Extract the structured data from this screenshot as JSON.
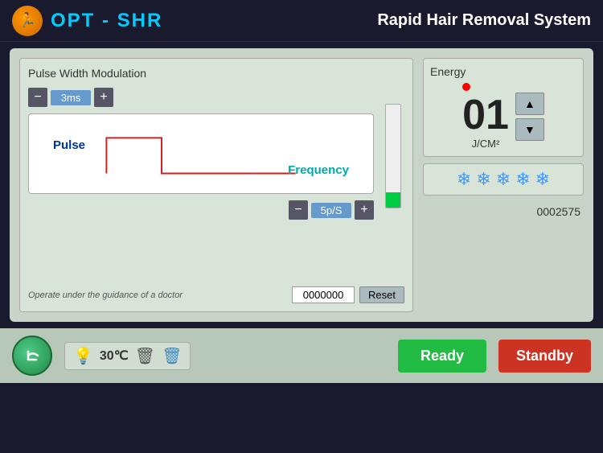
{
  "header": {
    "logo_text": "OPT - SHR",
    "title": "Rapid Hair Removal System",
    "logo_icon": "🏃"
  },
  "left_panel": {
    "title": "Pulse Width Modulation",
    "pulse_minus": "−",
    "pulse_plus": "+",
    "pulse_value": "3ms",
    "pulse_label": "Pulse",
    "frequency_label": "Frequency",
    "freq_minus": "−",
    "freq_plus": "+",
    "freq_value": "5p/S",
    "disclaimer": "Operate under the guidance of a doctor",
    "counter_value": "0000000",
    "reset_label": "Reset"
  },
  "right_panel": {
    "energy_title": "Energy",
    "energy_value": "01",
    "energy_unit": "J/CM²",
    "up_arrow": "▲",
    "down_arrow": "▼",
    "total_counter": "0002575",
    "snowflakes": [
      "❄",
      "❄",
      "❄",
      "❄",
      "❄"
    ]
  },
  "bottom_bar": {
    "temperature": "30℃",
    "ready_label": "Ready",
    "standby_label": "Standby"
  }
}
